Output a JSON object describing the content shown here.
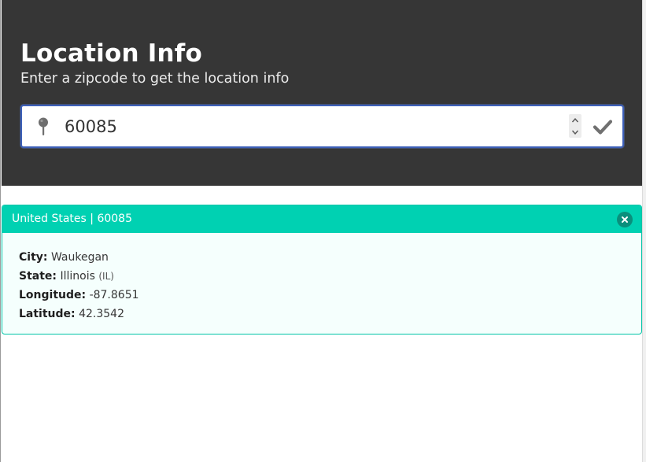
{
  "hero": {
    "title": "Location Info",
    "subtitle": "Enter a zipcode to get the location info"
  },
  "search": {
    "value": "60085",
    "icon": "map-pin-icon",
    "submit_icon": "checkmark-icon"
  },
  "result": {
    "country": "United States",
    "separator": " | ",
    "zip": "60085",
    "fields": {
      "city_label": "City:",
      "city": "Waukegan",
      "state_label": "State:",
      "state": "Illinois",
      "state_abbr": "(IL)",
      "longitude_label": "Longitude:",
      "longitude": "-87.8651",
      "latitude_label": "Latitude:",
      "latitude": "42.3542"
    }
  },
  "colors": {
    "hero_bg": "#363636",
    "accent": "#00d1b2",
    "input_border": "#3d5fb8"
  }
}
